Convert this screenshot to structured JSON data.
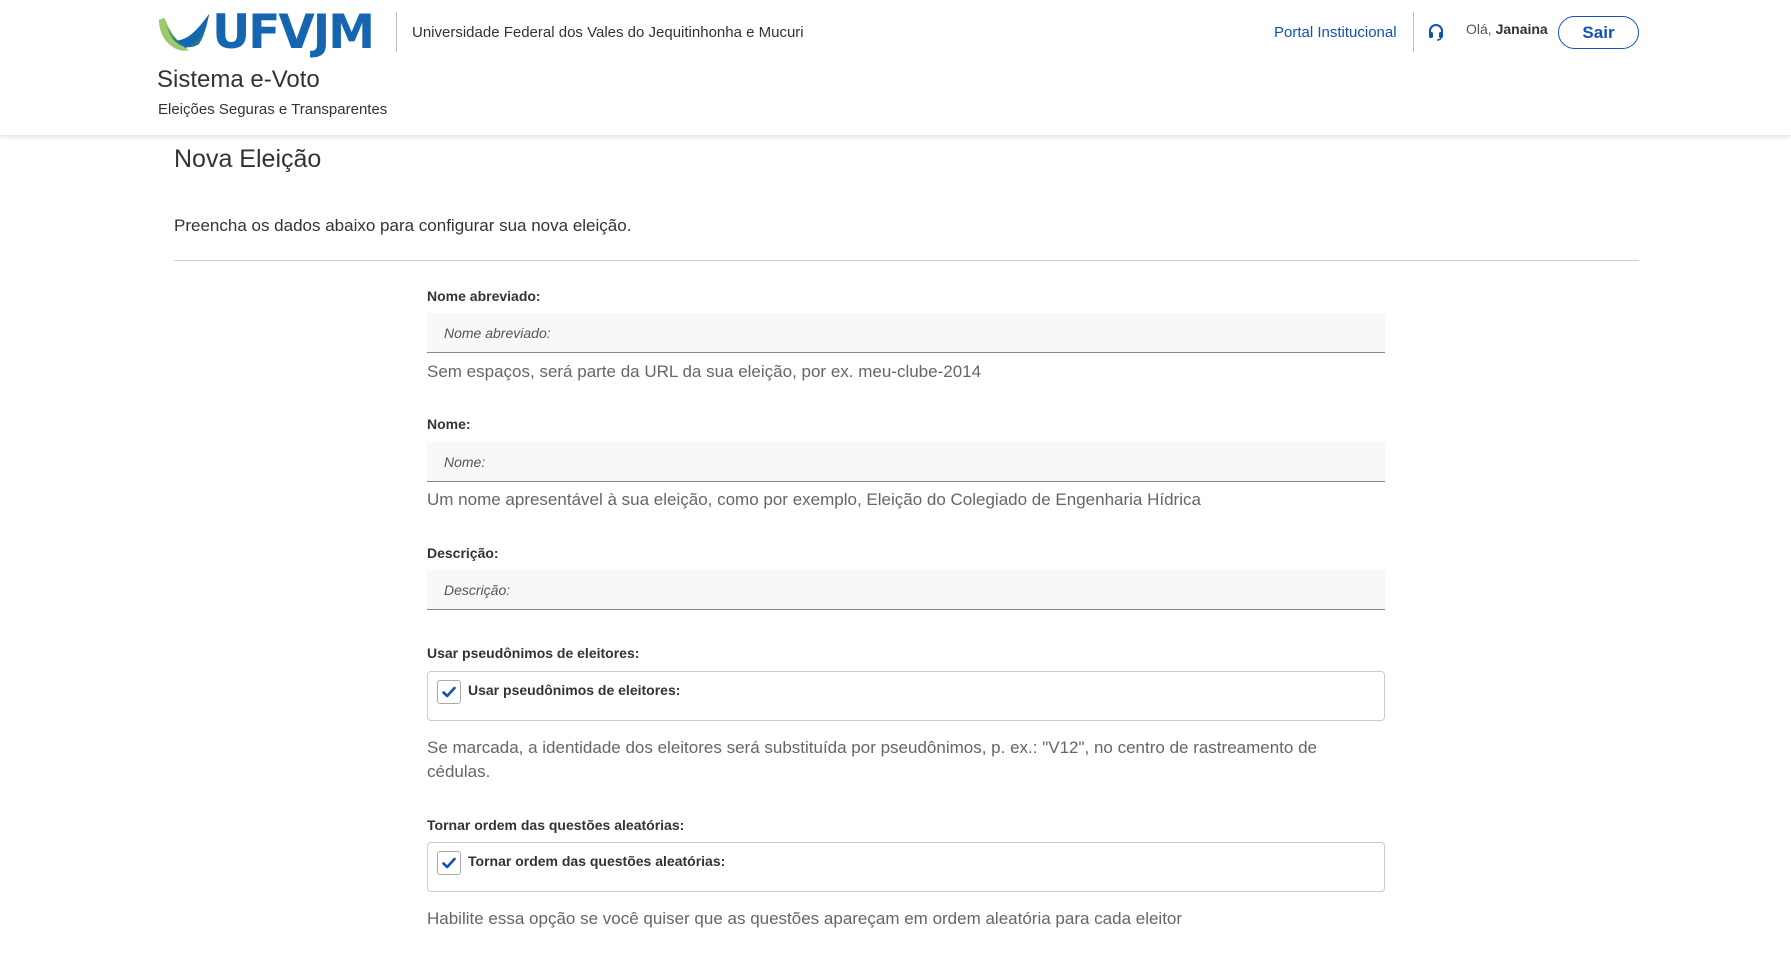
{
  "header": {
    "logo_text": "UFVJM",
    "university_name": "Universidade Federal dos Vales do Jequitinhonha e Mucuri",
    "system_title": "Sistema e-Voto",
    "system_subtitle": "Eleições Seguras e Transparentes",
    "portal_link": "Portal Institucional",
    "support_icon": "headset-icon",
    "greeting": "Olá,",
    "user_name": "Janaina",
    "logout_label": "Sair"
  },
  "page": {
    "title": "Nova Eleição",
    "intro": "Preencha os dados abaixo para configurar sua nova eleição."
  },
  "form": {
    "short_name": {
      "label": "Nome abreviado:",
      "value": "",
      "placeholder": "Nome abreviado:",
      "help": "Sem espaços, será parte da URL da sua eleição, por ex. meu-clube-2014"
    },
    "name": {
      "label": "Nome:",
      "value": "",
      "placeholder": "Nome:",
      "help": "Um nome apresentável à sua eleição, como por exemplo, Eleição do Colegiado de Engenharia Hídrica"
    },
    "description": {
      "label": "Descrição:",
      "value": "",
      "placeholder": "Descrição:"
    },
    "pseudonyms": {
      "label": "Usar pseudônimos de eleitores:",
      "checkbox_label": "Usar pseudônimos de eleitores:",
      "checked": true,
      "help": "Se marcada, a identidade dos eleitores será substituída por pseudônimos, p. ex.: \"V12\", no centro de rastreamento de cédulas."
    },
    "random_order": {
      "label": "Tornar ordem das questões aleatórias:",
      "checkbox_label": "Tornar ordem das questões aleatórias:",
      "checked": true,
      "help": "Habilite essa opção se você quiser que as questões apareçam em ordem aleatória para cada eleitor"
    }
  },
  "colors": {
    "brand_blue": "#1351b4",
    "logo_blue": "#1565b0",
    "logo_green": "#8cc152",
    "check_blue": "#1351b4"
  }
}
